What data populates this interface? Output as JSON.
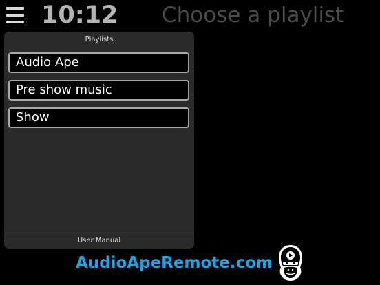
{
  "header": {
    "menu_icon": "hamburger-menu-icon",
    "time": "10:12",
    "title": "Choose a playlist"
  },
  "panel": {
    "title": "Playlists",
    "items": [
      {
        "label": "Audio Ape"
      },
      {
        "label": "Pre show music"
      },
      {
        "label": "Show"
      }
    ],
    "footer": "User Manual"
  },
  "footer": {
    "site": "AudioApeRemote.com",
    "logo_icon": "audio-ape-logo-icon"
  },
  "colors": {
    "background": "#000000",
    "panel": "#2b2b2b",
    "accent": "#1ea3e6",
    "clock": "#b4b4b4",
    "title": "#4a4a4a"
  }
}
